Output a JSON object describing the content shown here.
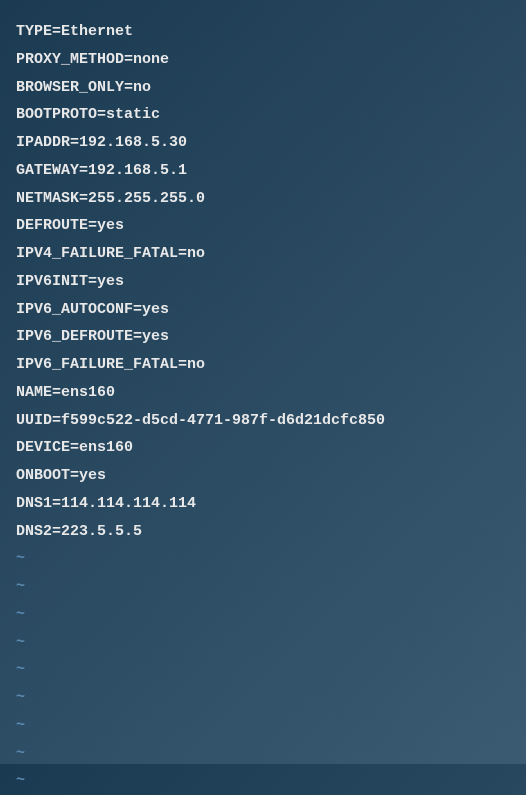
{
  "editor": {
    "lines": [
      "TYPE=Ethernet",
      "PROXY_METHOD=none",
      "BROWSER_ONLY=no",
      "BOOTPROTO=static",
      "IPADDR=192.168.5.30",
      "GATEWAY=192.168.5.1",
      "NETMASK=255.255.255.0",
      "DEFROUTE=yes",
      "IPV4_FAILURE_FATAL=no",
      "IPV6INIT=yes",
      "IPV6_AUTOCONF=yes",
      "IPV6_DEFROUTE=yes",
      "IPV6_FAILURE_FATAL=no",
      "NAME=ens160",
      "UUID=f599c522-d5cd-4771-987f-d6d21dcfc850",
      "DEVICE=ens160",
      "ONBOOT=yes",
      "DNS1=114.114.114.114",
      "DNS2=223.5.5.5"
    ],
    "tilde": "~",
    "empty_line_count": 9
  }
}
